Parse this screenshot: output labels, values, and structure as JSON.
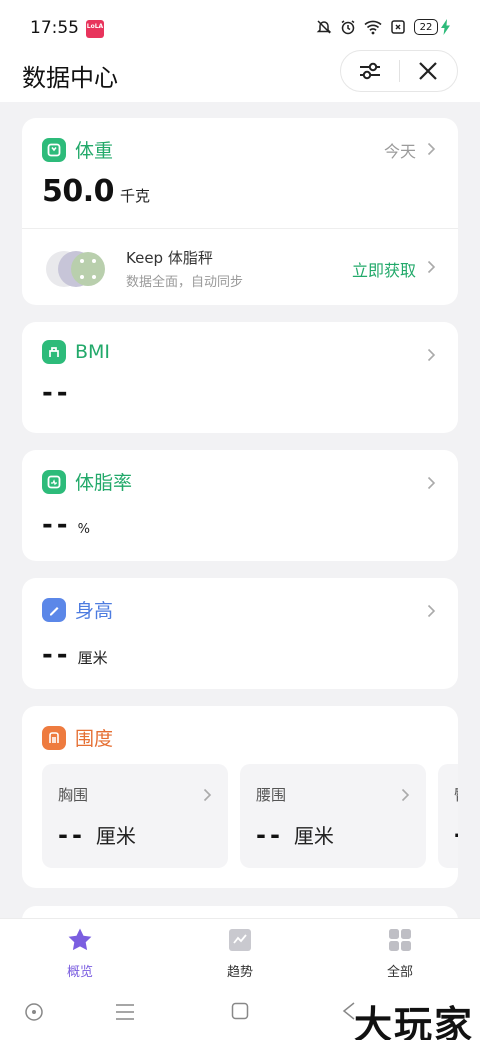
{
  "status": {
    "time": "17:55",
    "app_badge": "LoLA",
    "battery": "22"
  },
  "header": {
    "title": "数据中心"
  },
  "weight": {
    "title": "体重",
    "date": "今天",
    "value": "50.0",
    "unit": "千克",
    "promo": {
      "name": "Keep 体脂秤",
      "subtitle": "数据全面，自动同步",
      "action": "立即获取"
    }
  },
  "bmi": {
    "title": "BMI",
    "value": "--"
  },
  "bodyfat": {
    "title": "体脂率",
    "value": "--",
    "unit": "%"
  },
  "height": {
    "title": "身高",
    "value": "--",
    "unit": "厘米"
  },
  "girth": {
    "title": "围度",
    "items": [
      {
        "label": "胸围",
        "value": "--",
        "unit": "厘米"
      },
      {
        "label": "腰围",
        "value": "--",
        "unit": "厘米"
      },
      {
        "label": "臀",
        "value": "--",
        "unit": ""
      }
    ]
  },
  "tabs": [
    {
      "label": "概览",
      "active": true
    },
    {
      "label": "趋势"
    },
    {
      "label": "全部"
    }
  ],
  "watermark": "大玩家",
  "colors": {
    "green": "#2dbb7a",
    "blue": "#5b87e8",
    "orange": "#ee7b3f",
    "purple": "#7b5ee0"
  }
}
